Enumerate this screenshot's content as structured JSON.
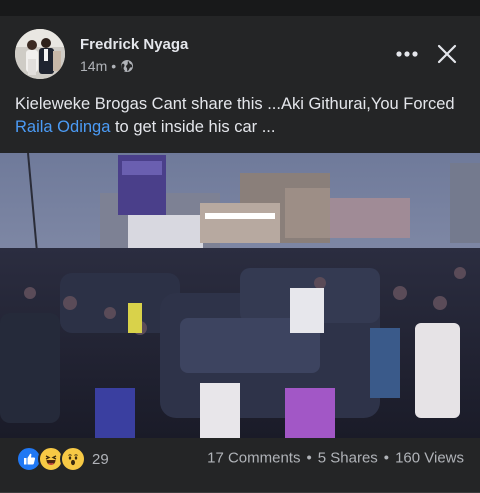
{
  "post": {
    "author": "Fredrick Nyaga",
    "time": "14m",
    "separator": "•",
    "text_before_link": "Kieleweke Brogas Cant share  this ...Aki Githurai,You Forced ",
    "text_link": "Raila Odinga",
    "text_after_link": "  to get inside his car ..."
  },
  "reactions": {
    "icons": [
      "like-icon",
      "laugh-icon",
      "wow-icon"
    ],
    "count": "29"
  },
  "stats": {
    "comments": "17 Comments",
    "shares": "5 Shares",
    "views": "160 Views",
    "dot": "•"
  },
  "colors": {
    "background": "#242526",
    "text": "#e4e6eb",
    "secondary": "#b0b3b8",
    "link": "#4b9bf5",
    "like_blue": "#2078f4",
    "reaction_yellow": "#f7c945"
  }
}
